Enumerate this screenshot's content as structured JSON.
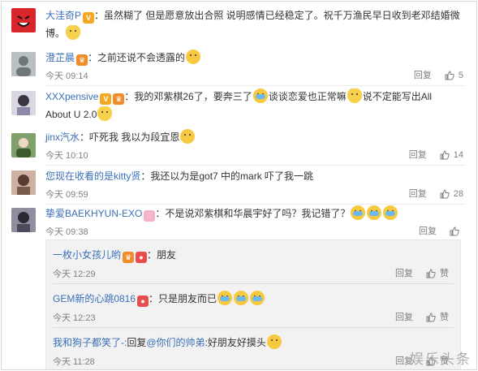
{
  "comments": [
    {
      "username": "大洼奇P",
      "text_line1": "：虽然糊了 但是愿意放出合照 说明感情已经稳定了。祝千万渔民早日收到老邓结婚微",
      "text_line2": "博。"
    },
    {
      "username": "澄芷晨",
      "text": "：之前还说不会透露的",
      "time": "今天 09:14",
      "reply": "回复",
      "likes": "5"
    },
    {
      "username": "XXXpensive",
      "text_line1": "：我的邓紫棋26了，要奔三了",
      "text_mid": "谈谈恋爱也正常嘛",
      "text_end": "说不定能写出All",
      "text_line2": "About U 2.0"
    },
    {
      "username": "jinx汽水",
      "text": "：吓死我 我以为段宜恩",
      "time": "今天 10:10",
      "reply": "回复",
      "likes": "14"
    },
    {
      "username": "您现在收看的是kitty贤",
      "text": "：我还以为是got7 中的mark 吓了我一跳",
      "time": "今天 09:59",
      "reply": "回复",
      "likes": "28"
    },
    {
      "username": "挚爱BAEKHYUN-EXO",
      "text": "：不是说邓紫棋和华晨宇好了吗？我记错了？",
      "time": "今天 09:38",
      "reply": "回复"
    }
  ],
  "replies": [
    {
      "username": "一枚小女孩儿哟",
      "text": "：朋友",
      "time": "今天 12:29",
      "reply": "回复",
      "like": "赞"
    },
    {
      "username": "GEM新的心跳0816",
      "text": "：只是朋友而已",
      "time": "今天 12:23",
      "reply": "回复",
      "like": "赞"
    },
    {
      "username": "我和狗子都笑了-:",
      "text_pre": "回复",
      "mention": "@你们的帅弟",
      "text": ":好朋友好摸头",
      "time": "今天 11:28",
      "reply": "回复",
      "like": "赞"
    }
  ],
  "watermark": "娱乐头条",
  "colors": {
    "username": "#eb7350",
    "link_blue": "#3b6fb6",
    "muted": "#808080"
  }
}
